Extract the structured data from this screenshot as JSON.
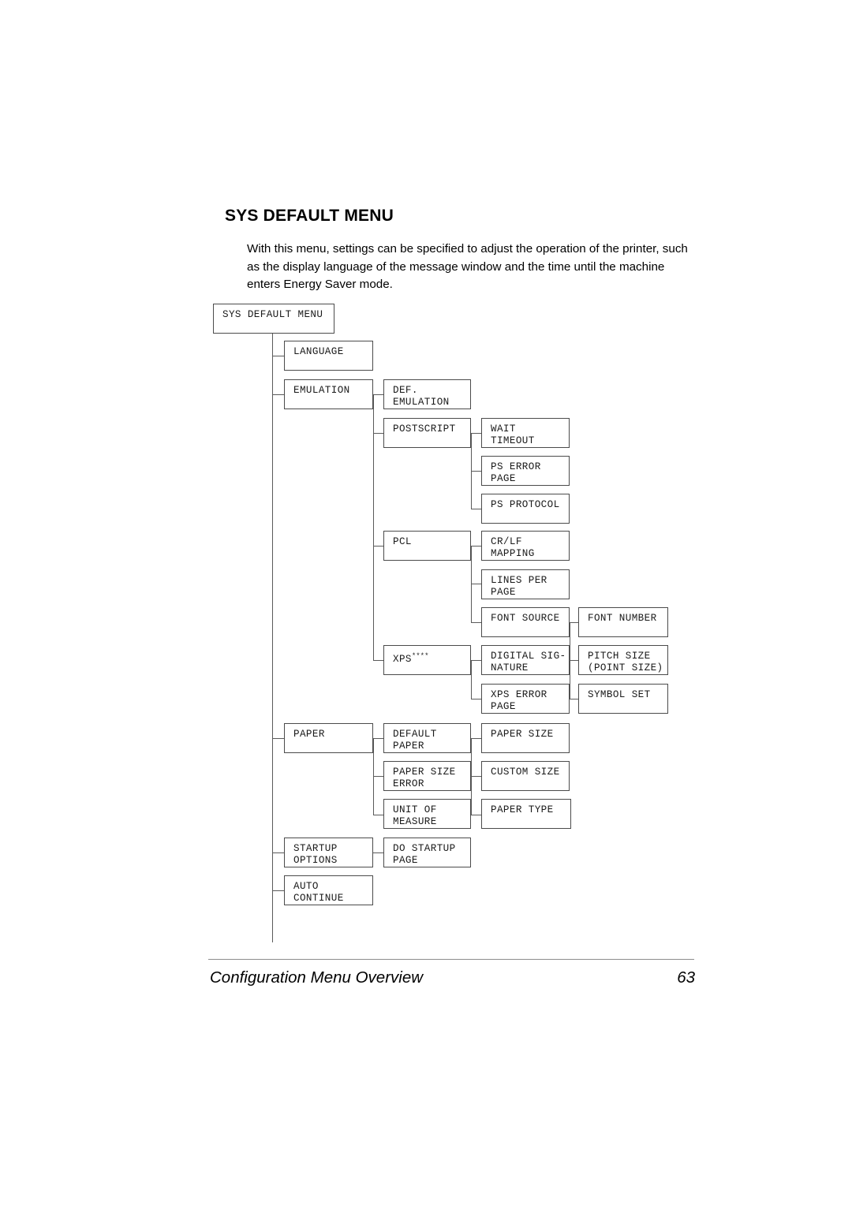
{
  "page": {
    "heading": "SYS DEFAULT MENU",
    "intro": "With this menu, settings can be specified to adjust the operation of the printer, such as the display language of the message window and the time until the machine enters Energy Saver mode.",
    "footer_title": "Configuration Menu Overview",
    "footer_page_number": "63"
  },
  "diagram": {
    "root": {
      "label": "SYS DEFAULT MENU"
    },
    "nodes": {
      "language": {
        "label": "LANGUAGE"
      },
      "emulation": {
        "label": "EMULATION"
      },
      "def_emulation": {
        "label": "DEF.\nEMULATION"
      },
      "postscript": {
        "label": "POSTSCRIPT"
      },
      "wait_timeout": {
        "label": "WAIT\nTIMEOUT"
      },
      "ps_error_page": {
        "label": "PS ERROR\nPAGE"
      },
      "ps_protocol": {
        "label": "PS PROTOCOL"
      },
      "pcl": {
        "label": "PCL"
      },
      "crlf_mapping": {
        "label": "CR/LF\nMAPPING"
      },
      "lines_per_page": {
        "label": "LINES PER\nPAGE"
      },
      "font_source": {
        "label": "FONT SOURCE"
      },
      "font_number": {
        "label": "FONT NUMBER"
      },
      "xps": {
        "label": "XPS",
        "footnote_marks": "****"
      },
      "digital_signature": {
        "label": "DIGITAL SIG-\nNATURE"
      },
      "pitch_size": {
        "label": "PITCH SIZE\n(POINT SIZE)"
      },
      "xps_error_page": {
        "label": "XPS ERROR\nPAGE"
      },
      "symbol_set": {
        "label": "SYMBOL SET"
      },
      "paper": {
        "label": "PAPER"
      },
      "default_paper": {
        "label": "DEFAULT\nPAPER"
      },
      "paper_size": {
        "label": "PAPER SIZE"
      },
      "paper_size_error": {
        "label": "PAPER SIZE\nERROR"
      },
      "custom_size": {
        "label": "CUSTOM SIZE"
      },
      "unit_of_measure": {
        "label": "UNIT OF\nMEASURE"
      },
      "paper_type": {
        "label": "PAPER TYPE"
      },
      "startup_options": {
        "label": "STARTUP\nOPTIONS"
      },
      "do_startup_page": {
        "label": "DO STARTUP\nPAGE"
      },
      "auto_continue": {
        "label": "AUTO\nCONTINUE"
      }
    },
    "colors": {
      "box_border": "#4b4b4b",
      "connector": "#5a5a5a",
      "text": "#1a1a1a"
    }
  }
}
